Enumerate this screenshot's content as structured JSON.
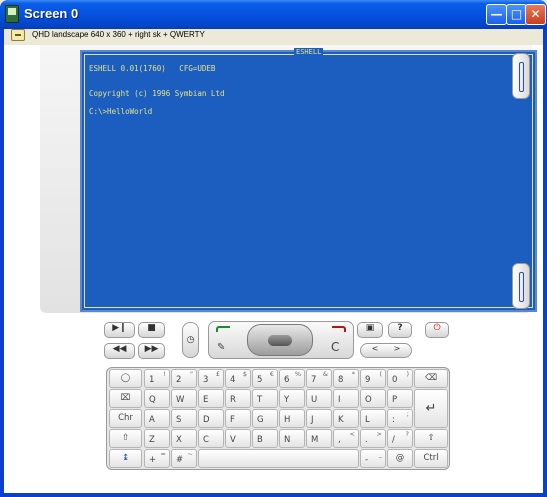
{
  "window": {
    "title": "Screen 0",
    "menu_text": "QHD landscape 640 x 360 + right sk + QWERTY"
  },
  "screen": {
    "title": "ESHELL",
    "lines": [
      "ESHELL 0.01(1760)   CFG=UDEB",
      "Copyright (c) 1996 Symbian Ltd",
      "C:\\>HelloWorld"
    ]
  },
  "controls": {
    "ok_label": "C",
    "question_label": "?"
  },
  "keyboard": {
    "rows": [
      [
        [
          "",
          "",
          ""
        ],
        [
          "1",
          "!"
        ],
        [
          "2",
          "\""
        ],
        [
          "3",
          "£"
        ],
        [
          "4",
          "$"
        ],
        [
          "5",
          "€"
        ],
        [
          "6",
          "%"
        ],
        [
          "7",
          "&"
        ],
        [
          "8",
          "*"
        ],
        [
          "9",
          "("
        ],
        [
          "0",
          ")"
        ]
      ],
      [
        [
          "",
          ""
        ],
        [
          "Q",
          ""
        ],
        [
          "W",
          ""
        ],
        [
          "E",
          ""
        ],
        [
          "R",
          ""
        ],
        [
          "T",
          ""
        ],
        [
          "Y",
          ""
        ],
        [
          "U",
          ""
        ],
        [
          "I",
          ""
        ],
        [
          "O",
          ""
        ],
        [
          "P",
          ""
        ],
        [
          "",
          ""
        ]
      ],
      [
        [
          "Chr",
          ""
        ],
        [
          "A",
          ""
        ],
        [
          "S",
          ""
        ],
        [
          "D",
          ""
        ],
        [
          "F",
          ""
        ],
        [
          "G",
          ""
        ],
        [
          "H",
          ""
        ],
        [
          "J",
          ""
        ],
        [
          "K",
          ""
        ],
        [
          "L",
          ""
        ],
        [
          ":",
          ""
        ]
      ],
      [
        [
          "",
          ""
        ],
        [
          "Z",
          ""
        ],
        [
          "X",
          ""
        ],
        [
          "C",
          ""
        ],
        [
          "V",
          ""
        ],
        [
          "B",
          ""
        ],
        [
          "N",
          ""
        ],
        [
          "M",
          ""
        ],
        [
          ",",
          "<"
        ],
        [
          ".",
          ">"
        ],
        [
          "/",
          "?"
        ],
        [
          "",
          ""
        ]
      ],
      [
        [
          "",
          ""
        ],
        [
          "+",
          "="
        ],
        [
          "#",
          "~"
        ],
        [
          "",
          ""
        ],
        [
          "-",
          "_"
        ],
        [
          "",
          ""
        ],
        [
          "Ctrl",
          ""
        ]
      ]
    ],
    "row_keys": {
      "r1": [
        {
          "m": "1",
          "a": "!"
        },
        {
          "m": "2",
          "a": "\""
        },
        {
          "m": "3",
          "a": "£"
        },
        {
          "m": "4",
          "a": "$"
        },
        {
          "m": "5",
          "a": "€"
        },
        {
          "m": "6",
          "a": "%"
        },
        {
          "m": "7",
          "a": "&"
        },
        {
          "m": "8",
          "a": "*"
        },
        {
          "m": "9",
          "a": "("
        },
        {
          "m": "0",
          "a": ")"
        }
      ],
      "r2": [
        "Q",
        "W",
        "E",
        "R",
        "T",
        "Y",
        "U",
        "I",
        "O",
        "P"
      ],
      "r3": [
        "A",
        "S",
        "D",
        "F",
        "G",
        "H",
        "J",
        "K",
        "L"
      ],
      "r4": [
        "Z",
        "X",
        "C",
        "V",
        "B",
        "N",
        "M"
      ],
      "chr_label": "Chr",
      "ctrl_label": "Ctrl",
      "colon": ":",
      "semicolon": ";",
      "comma": ",",
      "comma_alt": "<",
      "period": ".",
      "period_alt": ">",
      "slash": "/",
      "slash_alt": "?",
      "plus": "+",
      "plus_alt": "=",
      "hash": "#",
      "hash_alt": "~",
      "dash": "-",
      "dash_alt": "_"
    }
  }
}
